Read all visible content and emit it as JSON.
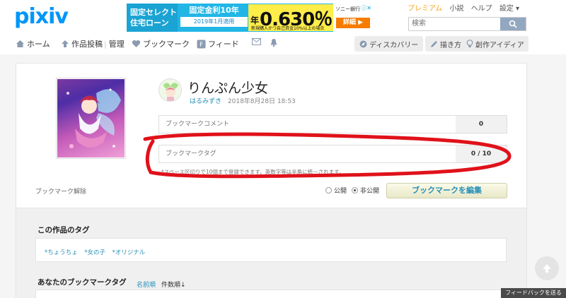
{
  "header": {
    "logo": "pixiv",
    "links": {
      "premium": "プレミアム",
      "novel": "小説",
      "help": "ヘルプ",
      "settings": "設定 ▾"
    },
    "search_placeholder": "検索"
  },
  "ad": {
    "left_line1": "固定セレクト",
    "left_line2": "住宅ローン",
    "mid_line1": "固定金利10年",
    "mid_line2": "2019年1月適用",
    "rate_prefix": "年",
    "rate": "0.630％",
    "note": "新規購入かつ自己資金10%以上の場合",
    "bank": "ソニー銀行",
    "cta": "詳細 ▶",
    "adchoice": "ⓘ✕"
  },
  "nav": {
    "home": "ホーム",
    "post": "作品投稿",
    "manage": "管理",
    "bookmarks": "ブックマーク",
    "feed": "フィード",
    "discovery": "ディスカバリー",
    "draw": "描き方",
    "idea": "創作アイディア"
  },
  "work": {
    "title": "りんぷん少女",
    "author": "はるみずき",
    "date": "2018年8月28日 18:53"
  },
  "form": {
    "comment_placeholder": "ブックマークコメント",
    "comment_count": "0",
    "tag_placeholder": "ブックマークタグ",
    "tag_count": "0 / 10",
    "hint": "*スペース区切りで10個まで登録できます。英数字等は半角に統一されます。",
    "remove": "ブックマーク解除",
    "public": "公開",
    "private": "非公開",
    "private_selected": true,
    "edit_button": "ブックマークを編集"
  },
  "work_tags": {
    "heading": "この作品のタグ",
    "tags": [
      "*ちょうちょ",
      "*女の子",
      "*オリジナル"
    ]
  },
  "my_tags": {
    "heading": "あなたのブックマークタグ",
    "sort_name": "名前順",
    "sort_count": "件数順↓"
  },
  "feedback": "フィードバックを送る",
  "colors": {
    "accent": "#0096fa",
    "link": "#258fb8",
    "annotation": "#e0111a"
  }
}
